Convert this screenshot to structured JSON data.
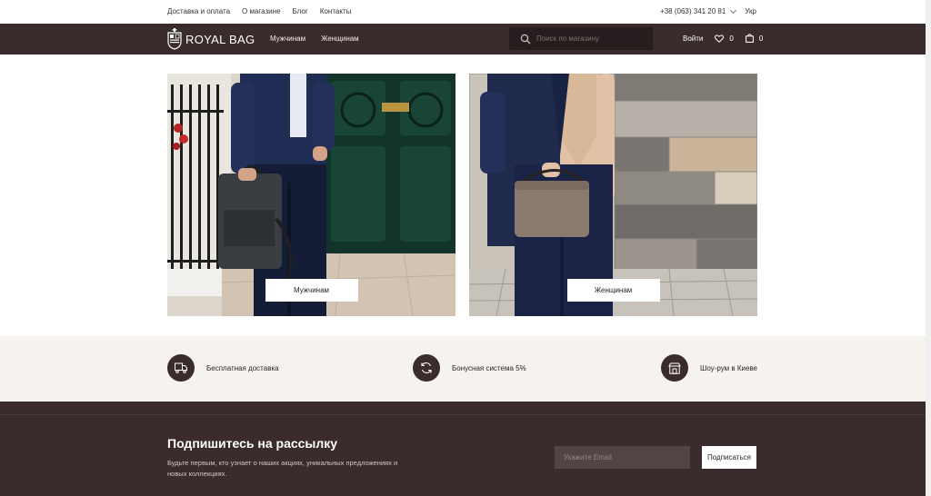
{
  "topbar": {
    "links": [
      "Доставка и оплата",
      "О магазине",
      "Блог",
      "Контакты"
    ],
    "phone": "+38 (063) 341 20 81",
    "language": "Укр"
  },
  "header": {
    "logo_text": "ROYAL BAG",
    "nav": [
      "Мужчинам",
      "Женщинам"
    ],
    "search_placeholder": "Поиск по магазину",
    "login_label": "Войти",
    "wishlist_count": "0",
    "cart_count": "0"
  },
  "categories": [
    {
      "label": "Мужчинам"
    },
    {
      "label": "Женщинам"
    }
  ],
  "features": [
    {
      "icon": "truck-icon",
      "label": "Бесплатная доставка"
    },
    {
      "icon": "refresh-icon",
      "label": "Бонусная система 5%"
    },
    {
      "icon": "store-icon",
      "label": "Шоу-рум в Киеве"
    }
  ],
  "newsletter": {
    "title": "Подпишитесь на рассылку",
    "text": "Будьте первым, кто узнает о наших акциях, уникальных предложениях и новых коллекциях.",
    "email_placeholder": "Укажите Email",
    "button_label": "Подписаться"
  },
  "colors": {
    "header_bg": "#3a2c2d",
    "features_bg": "#f6f2ee",
    "accent_dark": "#271d1e"
  }
}
